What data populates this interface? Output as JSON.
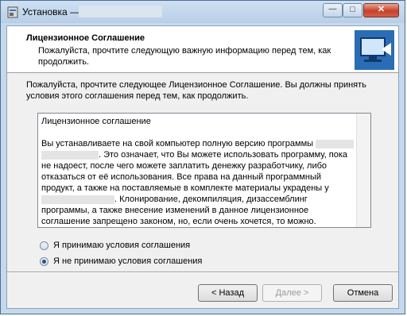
{
  "window": {
    "title": "Установка —",
    "minimize_glyph": "—",
    "maximize_glyph": "□",
    "close_glyph": "✕"
  },
  "header": {
    "title": "Лицензионное Соглашение",
    "subtitle": "Пожалуйста, прочтите следующую важную информацию перед тем, как продолжить."
  },
  "intro_text": "Пожалуйста, прочтите следующее Лицензионное Соглашение. Вы должны принять условия этого соглашения перед тем, как продолжить.",
  "license": {
    "heading": "Лицензионное соглашение",
    "line1": "Вы устанавливаете на свой компьютер полную версию программы",
    "line2_rest": ". Это означает, что Вы можете использовать программу, пока не надоест, после чего можете заплатить денежку разработчику, либо отказаться от её использования. Все права на данный программный продукт, а также на поставляемые в комплекте материалы украдены у",
    "line3": ". Клонирование, декомпиляция, дизассемблинг программы, а также внесение изменений в данное лицензионное соглашение запрещено законом, но, если очень хочется, то можно."
  },
  "options": {
    "accept": "Я принимаю условия соглашения",
    "decline": "Я не принимаю условия соглашения",
    "selected": "decline"
  },
  "buttons": {
    "back": "< Назад",
    "next": "Далее >",
    "cancel": "Отмена"
  },
  "colors": {
    "accent_radio": "#2b4f82",
    "close_button": "#c7412b"
  }
}
